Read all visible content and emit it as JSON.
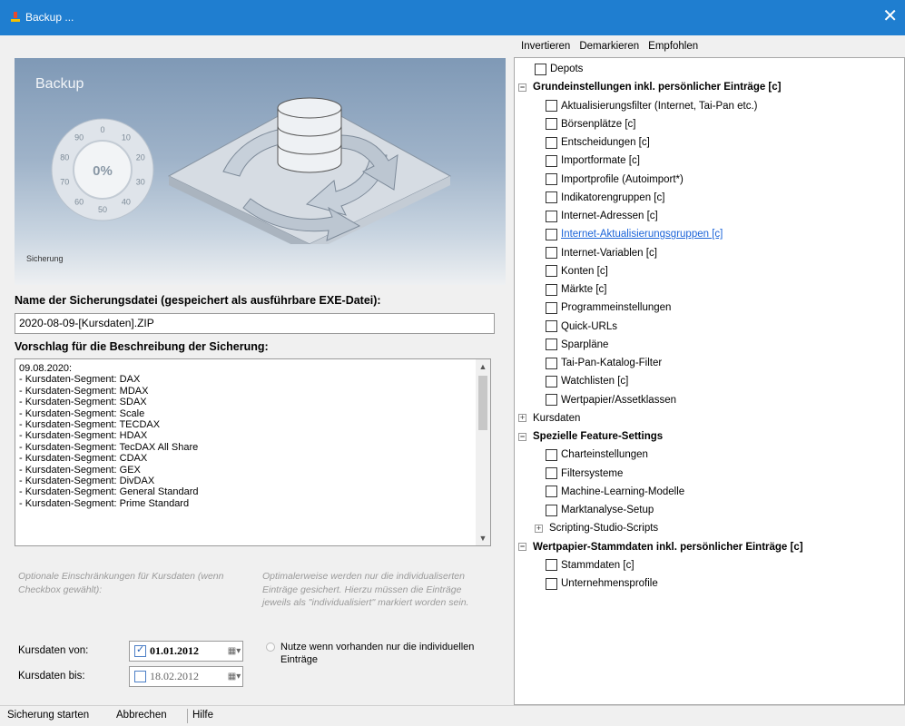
{
  "window": {
    "title": "Backup ...",
    "close_glyph": "✕"
  },
  "banner": {
    "title": "Backup",
    "caption": "Sicherung",
    "progress_percent": "0%",
    "dial_labels": [
      "0",
      "10",
      "20",
      "30",
      "40",
      "50",
      "60",
      "70",
      "80",
      "90"
    ]
  },
  "file": {
    "label": "Name der Sicherungsdatei (gespeichert als ausführbare EXE-Datei):",
    "value": "2020-08-09-[Kursdaten].ZIP"
  },
  "description": {
    "label": "Vorschlag für die Beschreibung der Sicherung:",
    "lines": [
      "09.08.2020:",
      "- Kursdaten-Segment: DAX",
      "- Kursdaten-Segment: MDAX",
      "- Kursdaten-Segment: SDAX",
      "- Kursdaten-Segment: Scale",
      "- Kursdaten-Segment: TECDAX",
      "- Kursdaten-Segment: HDAX",
      "- Kursdaten-Segment: TecDAX All Share",
      "- Kursdaten-Segment: CDAX",
      "- Kursdaten-Segment: GEX",
      "- Kursdaten-Segment: DivDAX",
      "- Kursdaten-Segment: General Standard",
      "- Kursdaten-Segment: Prime Standard"
    ]
  },
  "restrictions": {
    "hint_left": "Optionale Einschränkungen für Kursdaten (wenn Checkbox gewählt):",
    "hint_right": "Optimalerweise werden nur die individualiserten Einträge gesichert. Hierzu müssen die Einträge jeweils als \"individualisiert\" markiert worden sein.",
    "from_label": "Kursdaten von:",
    "from_value": "01.01.2012",
    "from_checked": true,
    "to_label": "Kursdaten bis:",
    "to_value": "18.02.2012",
    "to_checked": false,
    "option_text": "Nutze wenn vorhanden nur die individuellen Einträge"
  },
  "bottom": {
    "start": "Sicherung starten",
    "cancel": "Abbrechen",
    "help": "Hilfe"
  },
  "toolbar": {
    "invert": "Invertieren",
    "unmark": "Demarkieren",
    "recommended": "Empfohlen"
  },
  "tree": [
    {
      "text": "Depots",
      "kind": "check",
      "level": 1
    },
    {
      "text": "Grundeinstellungen inkl. persönlicher Einträge [c]",
      "kind": "group",
      "level": 0,
      "bold": true,
      "expander": "−"
    },
    {
      "text": "Aktualisierungsfilter (Internet, Tai-Pan etc.)",
      "kind": "check",
      "level": 2
    },
    {
      "text": "Börsenplätze [c]",
      "kind": "check",
      "level": 2
    },
    {
      "text": "Entscheidungen [c]",
      "kind": "check",
      "level": 2
    },
    {
      "text": "Importformate [c]",
      "kind": "check",
      "level": 2
    },
    {
      "text": "Importprofile (Autoimport*)",
      "kind": "check",
      "level": 2
    },
    {
      "text": "Indikatorengruppen [c]",
      "kind": "check",
      "level": 2
    },
    {
      "text": "Internet-Adressen [c]",
      "kind": "check",
      "level": 2
    },
    {
      "text": "Internet-Aktualisierungsgruppen [c]",
      "kind": "check",
      "level": 2,
      "link": true
    },
    {
      "text": "Internet-Variablen [c]",
      "kind": "check",
      "level": 2
    },
    {
      "text": "Konten [c]",
      "kind": "check",
      "level": 2
    },
    {
      "text": "Märkte [c]",
      "kind": "check",
      "level": 2
    },
    {
      "text": "Programmeinstellungen",
      "kind": "check",
      "level": 2
    },
    {
      "text": "Quick-URLs",
      "kind": "check",
      "level": 2
    },
    {
      "text": "Sparpläne",
      "kind": "check",
      "level": 2
    },
    {
      "text": "Tai-Pan-Katalog-Filter",
      "kind": "check",
      "level": 2
    },
    {
      "text": "Watchlisten [c]",
      "kind": "check",
      "level": 2
    },
    {
      "text": "Wertpapier/Assetklassen",
      "kind": "check",
      "level": 2
    },
    {
      "text": "Kursdaten",
      "kind": "group",
      "level": 0,
      "expander": "+"
    },
    {
      "text": "Spezielle Feature-Settings",
      "kind": "group",
      "level": 0,
      "bold": true,
      "expander": "−"
    },
    {
      "text": "Charteinstellungen",
      "kind": "check",
      "level": 2
    },
    {
      "text": "Filtersysteme",
      "kind": "check",
      "level": 2
    },
    {
      "text": "Machine-Learning-Modelle",
      "kind": "check",
      "level": 2
    },
    {
      "text": "Marktanalyse-Setup",
      "kind": "check",
      "level": 2
    },
    {
      "text": "Scripting-Studio-Scripts",
      "kind": "group",
      "level": 1,
      "expander": "+"
    },
    {
      "text": "Wertpapier-Stammdaten inkl. persönlicher Einträge [c]",
      "kind": "group",
      "level": 0,
      "bold": true,
      "expander": "−"
    },
    {
      "text": "Stammdaten [c]",
      "kind": "check",
      "level": 2
    },
    {
      "text": "Unternehmensprofile",
      "kind": "check",
      "level": 2
    }
  ]
}
